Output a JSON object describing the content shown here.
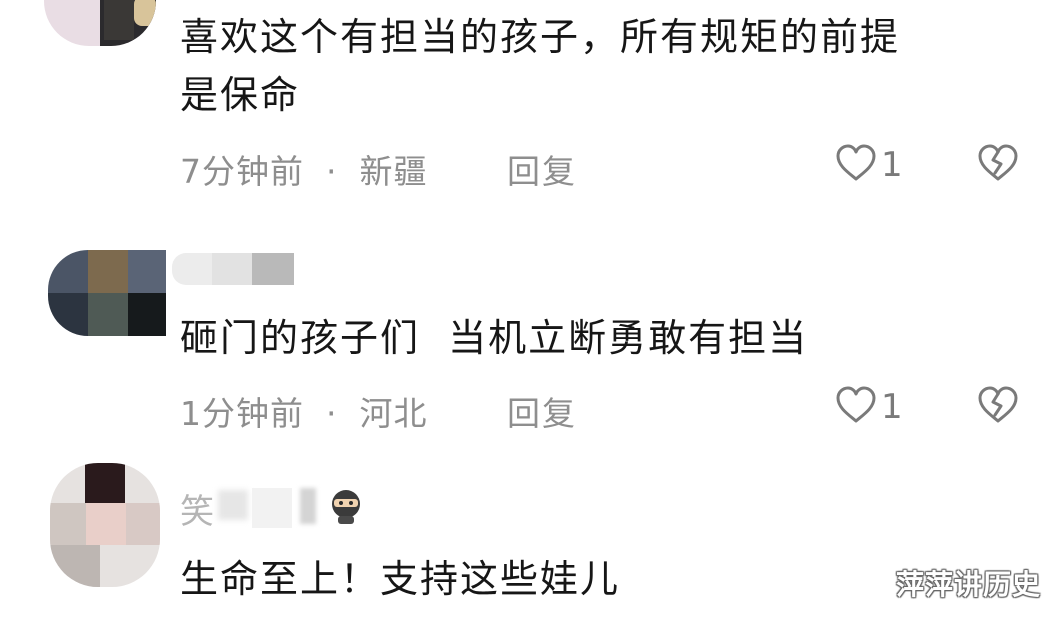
{
  "comments": [
    {
      "username": "",
      "text_line1": "喜欢这个有担当的孩子，所有规矩的前提",
      "text_line2": "是保命",
      "time": "7分钟前",
      "separator": "·",
      "location": "新疆",
      "reply_label": "回复",
      "likes": "1",
      "like_icon": "heart-outline-icon",
      "dislike_icon": "broken-heart-icon"
    },
    {
      "username": "",
      "text_line1": "砸门的孩子们  当机立断勇敢有担当",
      "time": "1分钟前",
      "separator": "·",
      "location": "河北",
      "reply_label": "回复",
      "likes": "1",
      "like_icon": "heart-outline-icon",
      "dislike_icon": "broken-heart-icon"
    },
    {
      "username": "笑",
      "text_line1": "生命至上！支持这些娃儿",
      "badge_icon": "ninja-emoji-icon"
    }
  ],
  "watermark": "萍萍讲历史",
  "colors": {
    "text": "#161616",
    "meta": "#8e8e8e",
    "icon": "#7a7a7a",
    "background": "#ffffff"
  }
}
